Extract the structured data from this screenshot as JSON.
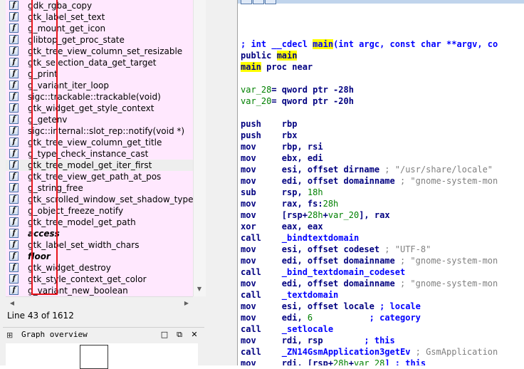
{
  "functions": {
    "items": [
      {
        "name": "gdk_rgba_copy"
      },
      {
        "name": "gtk_label_set_text"
      },
      {
        "name": "g_mount_get_icon"
      },
      {
        "name": "glibtop_get_proc_state"
      },
      {
        "name": "gtk_tree_view_column_set_resizable"
      },
      {
        "name": "gtk_selection_data_get_target"
      },
      {
        "name": "g_print"
      },
      {
        "name": "g_variant_iter_loop"
      },
      {
        "name": "sigc::trackable::trackable(void)"
      },
      {
        "name": "gtk_widget_get_style_context"
      },
      {
        "name": "g_getenv"
      },
      {
        "name": "sigc::internal::slot_rep::notify(void *)"
      },
      {
        "name": "gtk_tree_view_column_get_title"
      },
      {
        "name": "g_type_check_instance_cast"
      },
      {
        "name": "gtk_tree_model_get_iter_first"
      },
      {
        "name": "gtk_tree_view_get_path_at_pos"
      },
      {
        "name": "g_string_free"
      },
      {
        "name": "gtk_scrolled_window_set_shadow_type"
      },
      {
        "name": "g_object_freeze_notify"
      },
      {
        "name": "gtk_tree_model_get_path"
      },
      {
        "name": "access"
      },
      {
        "name": "gtk_label_set_width_chars"
      },
      {
        "name": "floor"
      },
      {
        "name": "gtk_widget_destroy"
      },
      {
        "name": "gtk_style_context_get_color"
      },
      {
        "name": "g_variant_new_boolean"
      }
    ],
    "icon_glyph": "f",
    "selected_index": 14,
    "bold_indices": [
      20,
      22
    ]
  },
  "status": {
    "line_info": "Line 43 of 1612"
  },
  "graph_overview": {
    "title": "Graph overview",
    "pin_glyph": "⊞",
    "min_glyph": "□",
    "restore_glyph": "⧉",
    "close_glyph": "✕"
  },
  "scroll_glyphs": {
    "down": "▼",
    "left": "◀",
    "right": "▶"
  },
  "colors": {
    "function_row_bg": "#ffe8fe",
    "selected_row_bg": "#eeeeee",
    "highlight_outline": "#e8141c",
    "code_keyword": "#000080",
    "code_comment": "#808080",
    "code_name": "#0000ff",
    "code_number": "#008000",
    "search_highlight": "#ffff00"
  },
  "code": {
    "lines": [
      [
        {
          "t": "; int __cdecl ",
          "c": "bl"
        },
        {
          "t": "main",
          "c": "bl hl"
        },
        {
          "t": "(int argc, const char **argv, co",
          "c": "bl"
        }
      ],
      [
        {
          "t": "public ",
          "c": "kw"
        },
        {
          "t": "main",
          "c": "kw hl"
        }
      ],
      [
        {
          "t": "main",
          "c": "kw hl"
        },
        {
          "t": " proc near",
          "c": "kw"
        }
      ],
      [],
      [
        {
          "t": "var_28",
          "c": "gr"
        },
        {
          "t": "= qword ptr -28h",
          "c": "kw"
        }
      ],
      [
        {
          "t": "var_20",
          "c": "gr"
        },
        {
          "t": "= qword ptr -20h",
          "c": "kw"
        }
      ],
      [],
      [
        {
          "t": "push    rbp",
          "c": "kw"
        }
      ],
      [
        {
          "t": "push    rbx",
          "c": "kw"
        }
      ],
      [
        {
          "t": "mov     rbp, rsi",
          "c": "kw"
        }
      ],
      [
        {
          "t": "mov     ebx, edi",
          "c": "kw"
        }
      ],
      [
        {
          "t": "mov     esi, offset dirname ",
          "c": "kw"
        },
        {
          "t": "; \"/usr/share/locale\"",
          "c": "cm"
        }
      ],
      [
        {
          "t": "mov     edi, offset domainname ",
          "c": "kw"
        },
        {
          "t": "; \"gnome-system-mon",
          "c": "cm"
        }
      ],
      [
        {
          "t": "sub     rsp, ",
          "c": "kw"
        },
        {
          "t": "18h",
          "c": "gr"
        }
      ],
      [
        {
          "t": "mov     rax, fs:",
          "c": "kw"
        },
        {
          "t": "28h",
          "c": "gr"
        }
      ],
      [
        {
          "t": "mov     [rsp+",
          "c": "kw"
        },
        {
          "t": "28h",
          "c": "gr"
        },
        {
          "t": "+",
          "c": "kw"
        },
        {
          "t": "var_20",
          "c": "gr"
        },
        {
          "t": "], rax",
          "c": "kw"
        }
      ],
      [
        {
          "t": "xor     eax, eax",
          "c": "kw"
        }
      ],
      [
        {
          "t": "call    ",
          "c": "kw"
        },
        {
          "t": "_bindtextdomain",
          "c": "bl"
        }
      ],
      [
        {
          "t": "mov     esi, offset codeset ",
          "c": "kw"
        },
        {
          "t": "; \"UTF-8\"",
          "c": "cm"
        }
      ],
      [
        {
          "t": "mov     edi, offset domainname ",
          "c": "kw"
        },
        {
          "t": "; \"gnome-system-mon",
          "c": "cm"
        }
      ],
      [
        {
          "t": "call    ",
          "c": "kw"
        },
        {
          "t": "_bind_textdomain_codeset",
          "c": "bl"
        }
      ],
      [
        {
          "t": "mov     edi, offset domainname ",
          "c": "kw"
        },
        {
          "t": "; \"gnome-system-mon",
          "c": "cm"
        }
      ],
      [
        {
          "t": "call    ",
          "c": "kw"
        },
        {
          "t": "_textdomain",
          "c": "bl"
        }
      ],
      [
        {
          "t": "mov     esi, offset locale ",
          "c": "kw"
        },
        {
          "t": "; locale",
          "c": "bl"
        }
      ],
      [
        {
          "t": "mov     edi, ",
          "c": "kw"
        },
        {
          "t": "6",
          "c": "gr"
        },
        {
          "t": "           ",
          "c": "kw"
        },
        {
          "t": "; category",
          "c": "bl"
        }
      ],
      [
        {
          "t": "call    ",
          "c": "kw"
        },
        {
          "t": "_setlocale",
          "c": "bl"
        }
      ],
      [
        {
          "t": "mov     rdi, rsp        ",
          "c": "kw"
        },
        {
          "t": "; this",
          "c": "bl"
        }
      ],
      [
        {
          "t": "call    ",
          "c": "kw"
        },
        {
          "t": "_ZN14GsmApplication3getEv",
          "c": "bl"
        },
        {
          "t": " ; GsmApplication",
          "c": "cm"
        }
      ],
      [
        {
          "t": "mov     rdi, [rsp+",
          "c": "kw"
        },
        {
          "t": "28h",
          "c": "gr"
        },
        {
          "t": "+",
          "c": "kw"
        },
        {
          "t": "var_28",
          "c": "gr"
        },
        {
          "t": "] ; this",
          "c": "bl"
        }
      ]
    ]
  }
}
